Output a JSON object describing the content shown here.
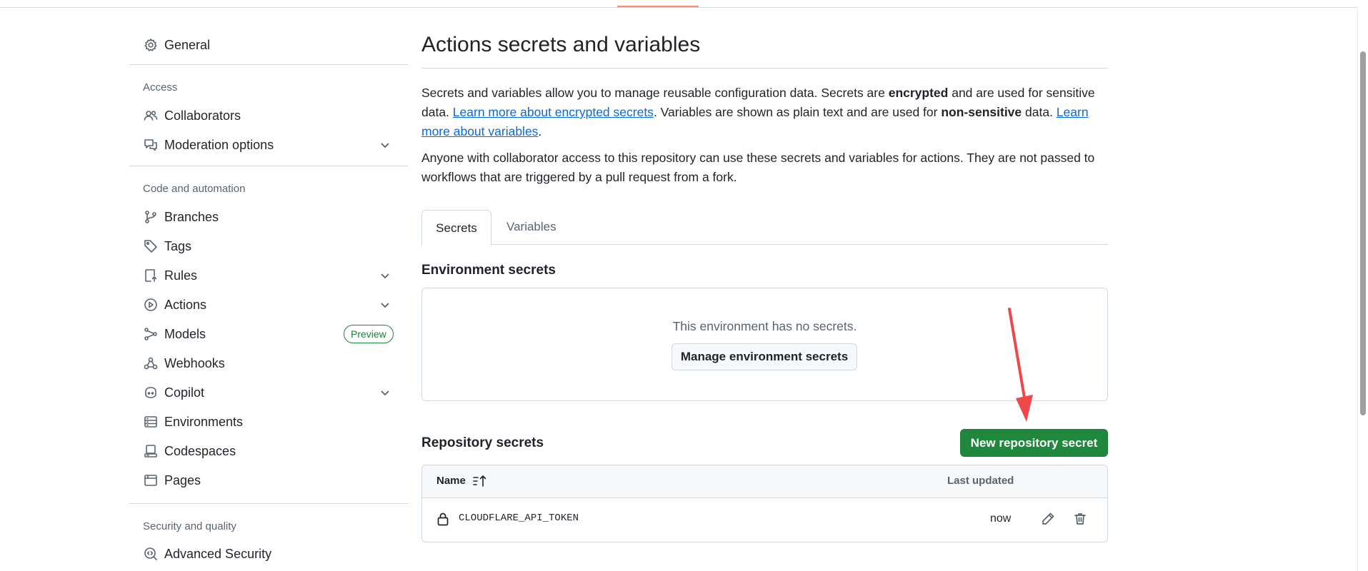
{
  "sidebar": {
    "general": "General",
    "access_title": "Access",
    "collaborators": "Collaborators",
    "moderation": "Moderation options",
    "code_title": "Code and automation",
    "branches": "Branches",
    "tags": "Tags",
    "rules": "Rules",
    "actions": "Actions",
    "models": "Models",
    "models_badge": "Preview",
    "webhooks": "Webhooks",
    "copilot": "Copilot",
    "environments": "Environments",
    "codespaces": "Codespaces",
    "pages": "Pages",
    "security_title": "Security and quality",
    "advanced_security": "Advanced Security"
  },
  "main": {
    "title": "Actions secrets and variables",
    "desc1": {
      "t1": "Secrets and variables allow you to manage reusable configuration data. Secrets are ",
      "b1": "encrypted",
      "t2": " and are used for sensitive data. ",
      "link1": "Learn more about encrypted secrets",
      "t3": ". Variables are shown as plain text and are used for ",
      "b2": "non-sensitive",
      "t4": " data. ",
      "link2": "Learn more about variables",
      "t5": "."
    },
    "desc2": "Anyone with collaborator access to this repository can use these secrets and variables for actions. They are not passed to workflows that are triggered by a pull request from a fork.",
    "tabs": [
      {
        "label": "Secrets",
        "active": true
      },
      {
        "label": "Variables",
        "active": false
      }
    ],
    "env_title": "Environment secrets",
    "env_empty": "This environment has no secrets.",
    "env_button": "Manage environment secrets",
    "repo_title": "Repository secrets",
    "new_secret_button": "New repository secret",
    "table": {
      "col_name": "Name",
      "col_updated": "Last updated",
      "rows": [
        {
          "name": "CLOUDFLARE_API_TOKEN",
          "updated": "now"
        }
      ]
    }
  },
  "colors": {
    "primary_button": "#1f883d",
    "link": "#0969da",
    "annotation_arrow": "#f04848",
    "active_tab_underline": "#fd8c73"
  }
}
